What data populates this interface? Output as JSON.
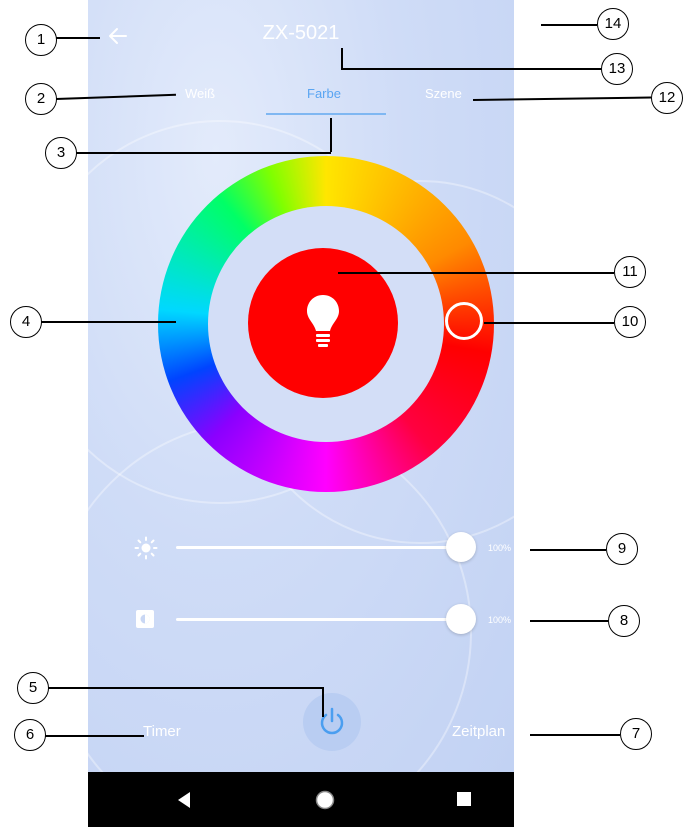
{
  "header": {
    "title": "ZX-5021"
  },
  "tabs": [
    "Weiß",
    "Farbe",
    "Szene"
  ],
  "sliders": {
    "brightness": {
      "value_label": "100%",
      "level": 1.0
    },
    "saturation": {
      "value_label": "100%",
      "level": 1.0
    }
  },
  "footer": {
    "timer_label": "Timer",
    "schedule_label": "Zeitplan"
  },
  "colors": {
    "selected": "#ff0000",
    "accent": "#5aa5f2",
    "background": "#cfdcf7",
    "navbar": "#000000"
  },
  "callouts": [
    "1",
    "2",
    "3",
    "4",
    "5",
    "6",
    "7",
    "8",
    "9",
    "10",
    "11",
    "12",
    "13",
    "14"
  ],
  "icons": [
    "back-arrow-icon",
    "edit-pencil-icon",
    "light-bulb-icon",
    "brightness-sun-icon",
    "saturation-icon",
    "power-icon",
    "nav-back-icon",
    "nav-home-icon",
    "nav-recents-icon",
    "accessibility-icon"
  ]
}
